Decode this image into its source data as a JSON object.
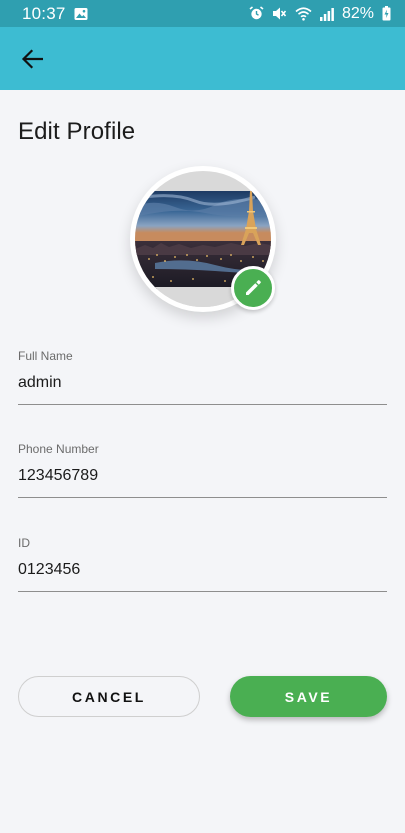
{
  "status_bar": {
    "time": "10:37",
    "battery_percent": "82%",
    "icons": [
      "image-icon",
      "alarm-icon",
      "mute-icon",
      "wifi-icon",
      "signal-icon",
      "battery-charging-icon"
    ]
  },
  "app_bar": {
    "back_icon": "arrow-left-icon",
    "color": "#3dbcd2"
  },
  "page": {
    "title": "Edit Profile"
  },
  "profile_photo": {
    "description_icon": "avatar",
    "edit_icon": "pencil-icon"
  },
  "form": {
    "full_name": {
      "label": "Full Name",
      "value": "admin"
    },
    "phone_number": {
      "label": "Phone Number",
      "value": "123456789"
    },
    "id": {
      "label": "ID",
      "value": "0123456"
    }
  },
  "actions": {
    "cancel_label": "CANCEL",
    "save_label": "SAVE"
  },
  "colors": {
    "accent": "#3dbcd2",
    "status_bar": "#2f9fb0",
    "save_button": "#4aaf52",
    "background": "#f4f5f8"
  }
}
